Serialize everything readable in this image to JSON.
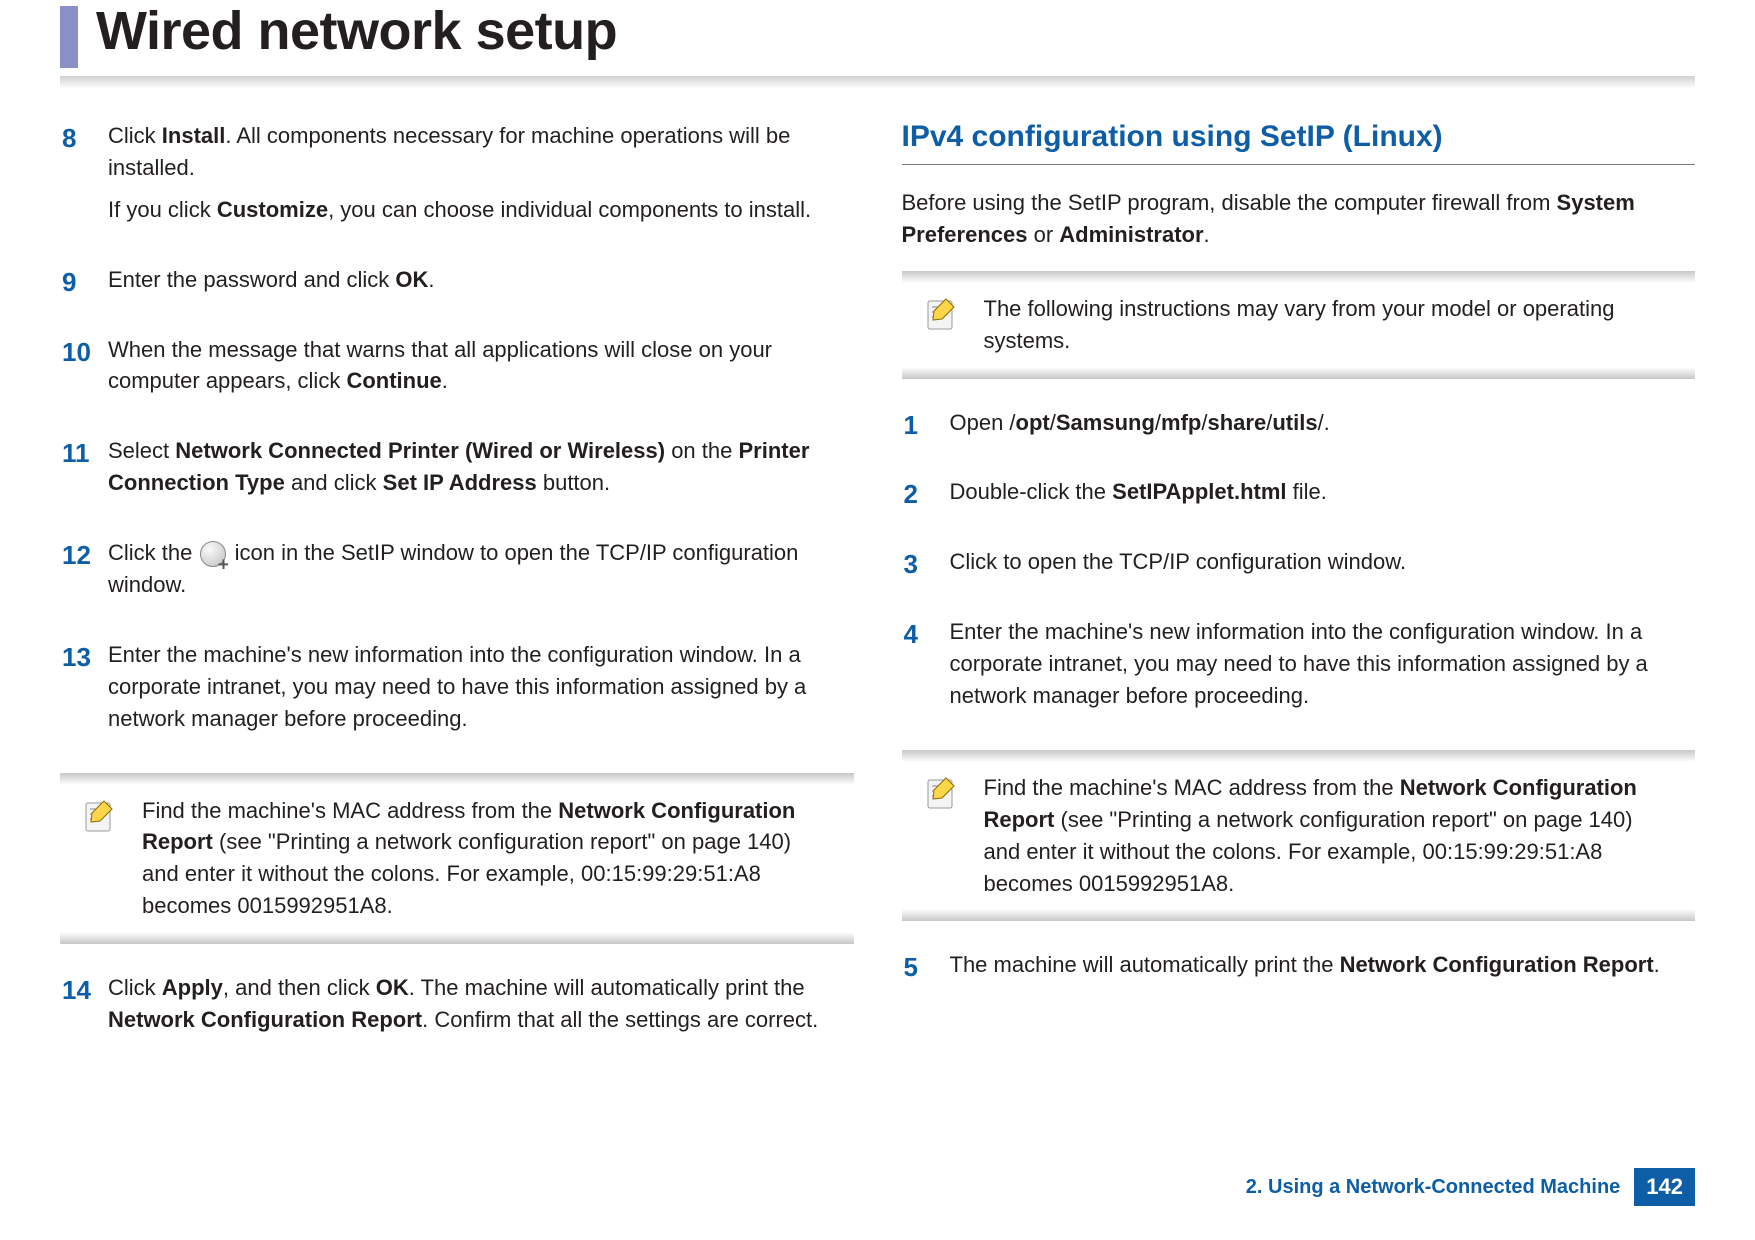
{
  "header": {
    "title": "Wired network setup"
  },
  "left_column": {
    "steps": [
      {
        "num": "8",
        "paragraphs": [
          [
            {
              "t": "Click "
            },
            {
              "t": "Install",
              "b": true
            },
            {
              "t": ". All components necessary for machine operations will be installed."
            }
          ],
          [
            {
              "t": "If you click "
            },
            {
              "t": "Customize",
              "b": true
            },
            {
              "t": ", you can choose individual components to install."
            }
          ]
        ]
      },
      {
        "num": "9",
        "paragraphs": [
          [
            {
              "t": "Enter the password and click "
            },
            {
              "t": "OK",
              "b": true
            },
            {
              "t": "."
            }
          ]
        ]
      },
      {
        "num": "10",
        "paragraphs": [
          [
            {
              "t": "When the message that warns that all applications will close on your computer appears, click "
            },
            {
              "t": "Continue",
              "b": true
            },
            {
              "t": "."
            }
          ]
        ]
      },
      {
        "num": "11",
        "paragraphs": [
          [
            {
              "t": "Select "
            },
            {
              "t": "Network Connected Printer (Wired or Wireless)",
              "b": true
            },
            {
              "t": " on the "
            },
            {
              "t": "Printer Connection Type",
              "b": true
            },
            {
              "t": " and click "
            },
            {
              "t": "Set IP Address",
              "b": true
            },
            {
              "t": " button."
            }
          ]
        ]
      },
      {
        "num": "12",
        "paragraphs": [
          [
            {
              "t": "Click the "
            },
            {
              "icon": "setip-add-icon"
            },
            {
              "t": " icon in the SetIP window to open the TCP/IP configuration window."
            }
          ]
        ]
      },
      {
        "num": "13",
        "paragraphs": [
          [
            {
              "t": "Enter the machine's new information into the configuration window. In a corporate intranet, you may need to have this information assigned by a network manager before proceeding."
            }
          ]
        ]
      }
    ],
    "note1": [
      {
        "t": "Find the machine's MAC address from the "
      },
      {
        "t": "Network Configuration Report",
        "b": true
      },
      {
        "t": " (see \"Printing a network configuration report\" on page 140) and enter it without the colons. For example, 00:15:99:29:51:A8 becomes 0015992951A8."
      }
    ],
    "step14": {
      "num": "14",
      "paragraphs": [
        [
          {
            "t": "Click "
          },
          {
            "t": "Apply",
            "b": true
          },
          {
            "t": ", and then click "
          },
          {
            "t": "OK",
            "b": true
          },
          {
            "t": ". The machine will automatically print the "
          },
          {
            "t": "Network Configuration Report",
            "b": true
          },
          {
            "t": ". Confirm that all the settings are correct."
          }
        ]
      ]
    }
  },
  "right_column": {
    "heading": "IPv4 configuration using SetIP (Linux)",
    "intro": [
      {
        "t": "Before using the SetIP program, disable the computer firewall from "
      },
      {
        "t": "System Preferences",
        "b": true
      },
      {
        "t": " or "
      },
      {
        "t": "Administrator",
        "b": true
      },
      {
        "t": "."
      }
    ],
    "note_top": [
      {
        "t": "The following instructions may vary from your model or operating systems."
      }
    ],
    "steps": [
      {
        "num": "1",
        "paragraphs": [
          [
            {
              "t": "Open /"
            },
            {
              "t": "opt",
              "b": true
            },
            {
              "t": "/"
            },
            {
              "t": "Samsung",
              "b": true
            },
            {
              "t": "/"
            },
            {
              "t": "mfp",
              "b": true
            },
            {
              "t": "/"
            },
            {
              "t": "share",
              "b": true
            },
            {
              "t": "/"
            },
            {
              "t": "utils",
              "b": true
            },
            {
              "t": "/."
            }
          ]
        ]
      },
      {
        "num": "2",
        "paragraphs": [
          [
            {
              "t": "Double-click the "
            },
            {
              "t": "SetIPApplet.html",
              "b": true
            },
            {
              "t": " file."
            }
          ]
        ]
      },
      {
        "num": "3",
        "paragraphs": [
          [
            {
              "t": "Click to open the TCP/IP configuration window."
            }
          ]
        ]
      },
      {
        "num": "4",
        "paragraphs": [
          [
            {
              "t": "Enter the machine's new information into the configuration window. In a corporate intranet, you may need to have this information assigned by a network manager before proceeding."
            }
          ]
        ]
      }
    ],
    "note_mid": [
      {
        "t": "Find the machine's MAC address from the "
      },
      {
        "t": "Network Configuration Report",
        "b": true
      },
      {
        "t": " (see \"Printing a network configuration report\" on page 140) and enter it without the colons. For example, 00:15:99:29:51:A8 becomes 0015992951A8."
      }
    ],
    "step5": {
      "num": "5",
      "paragraphs": [
        [
          {
            "t": "The machine will automatically print the "
          },
          {
            "t": "Network Configuration Report",
            "b": true
          },
          {
            "t": "."
          }
        ]
      ]
    }
  },
  "footer": {
    "chapter": "2.  Using a Network-Connected Machine",
    "page": "142"
  }
}
